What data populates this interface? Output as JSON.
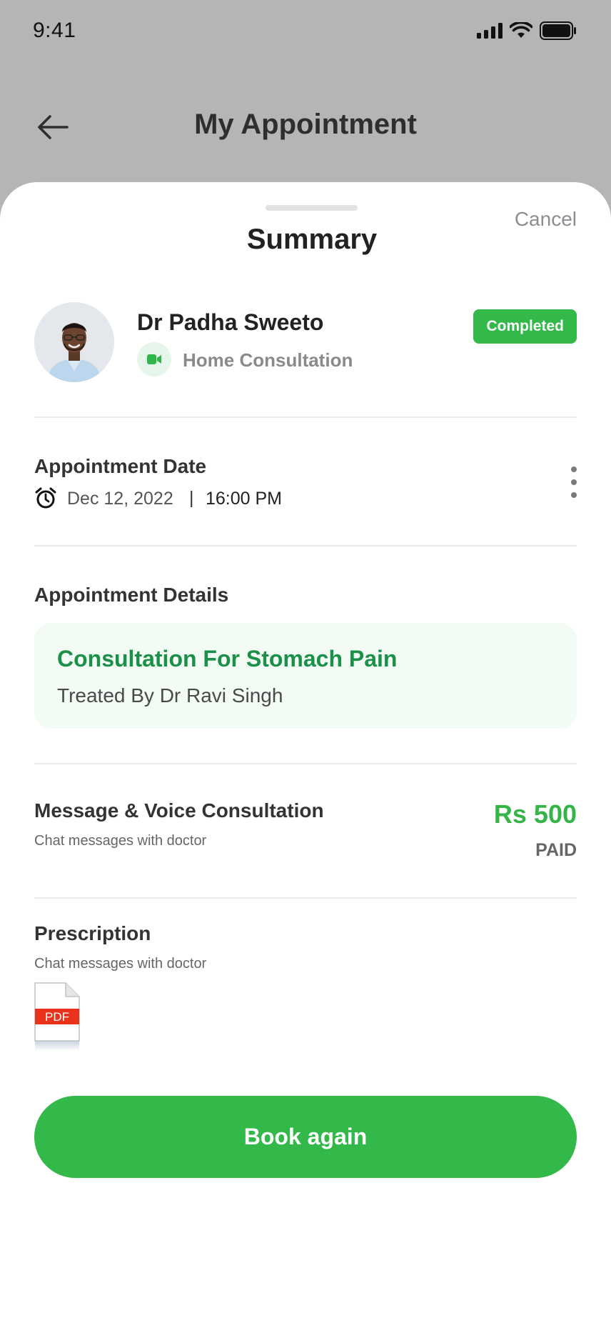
{
  "status_bar": {
    "time": "9:41"
  },
  "header": {
    "title": "My Appointment"
  },
  "sheet": {
    "title": "Summary",
    "cancel_label": "Cancel"
  },
  "doctor": {
    "name": "Dr Padha Sweeto",
    "consultation_type": "Home Consultation",
    "status": "Completed"
  },
  "appointment_date": {
    "label": "Appointment Date",
    "date": "Dec 12, 2022",
    "separator": "|",
    "time": "16:00 PM"
  },
  "appointment_details": {
    "label": "Appointment Details",
    "title": "Consultation For Stomach Pain",
    "treated_by": "Treated By Dr Ravi Singh"
  },
  "fee": {
    "title": "Message & Voice Consultation",
    "subtitle": "Chat messages with doctor",
    "amount": "Rs 500",
    "status": "PAID"
  },
  "prescription": {
    "title": "Prescription",
    "subtitle": "Chat messages with doctor",
    "file_label": "PDF"
  },
  "actions": {
    "book_again": "Book again"
  },
  "colors": {
    "accent_green": "#33b84a",
    "detail_title_green": "#1a9048",
    "backdrop_gray": "#b5b5b5",
    "pdf_red": "#e8321c"
  }
}
